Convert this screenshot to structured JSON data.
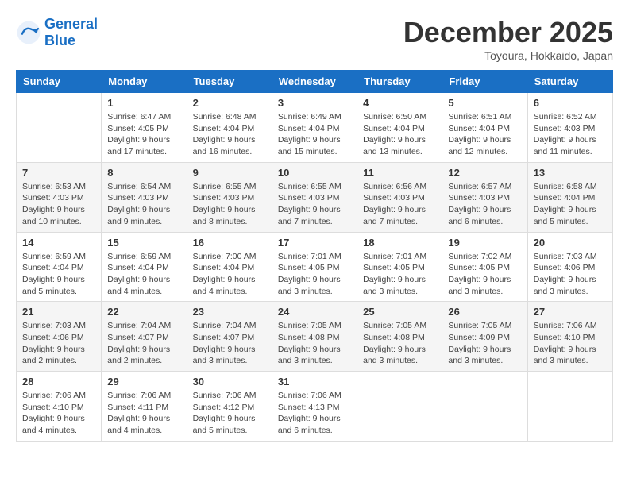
{
  "header": {
    "logo_general": "General",
    "logo_blue": "Blue",
    "month_title": "December 2025",
    "location": "Toyoura, Hokkaido, Japan"
  },
  "weekdays": [
    "Sunday",
    "Monday",
    "Tuesday",
    "Wednesday",
    "Thursday",
    "Friday",
    "Saturday"
  ],
  "weeks": [
    [
      {
        "day": "",
        "sunrise": "",
        "sunset": "",
        "daylight": ""
      },
      {
        "day": "1",
        "sunrise": "Sunrise: 6:47 AM",
        "sunset": "Sunset: 4:05 PM",
        "daylight": "Daylight: 9 hours and 17 minutes."
      },
      {
        "day": "2",
        "sunrise": "Sunrise: 6:48 AM",
        "sunset": "Sunset: 4:04 PM",
        "daylight": "Daylight: 9 hours and 16 minutes."
      },
      {
        "day": "3",
        "sunrise": "Sunrise: 6:49 AM",
        "sunset": "Sunset: 4:04 PM",
        "daylight": "Daylight: 9 hours and 15 minutes."
      },
      {
        "day": "4",
        "sunrise": "Sunrise: 6:50 AM",
        "sunset": "Sunset: 4:04 PM",
        "daylight": "Daylight: 9 hours and 13 minutes."
      },
      {
        "day": "5",
        "sunrise": "Sunrise: 6:51 AM",
        "sunset": "Sunset: 4:04 PM",
        "daylight": "Daylight: 9 hours and 12 minutes."
      },
      {
        "day": "6",
        "sunrise": "Sunrise: 6:52 AM",
        "sunset": "Sunset: 4:03 PM",
        "daylight": "Daylight: 9 hours and 11 minutes."
      }
    ],
    [
      {
        "day": "7",
        "sunrise": "Sunrise: 6:53 AM",
        "sunset": "Sunset: 4:03 PM",
        "daylight": "Daylight: 9 hours and 10 minutes."
      },
      {
        "day": "8",
        "sunrise": "Sunrise: 6:54 AM",
        "sunset": "Sunset: 4:03 PM",
        "daylight": "Daylight: 9 hours and 9 minutes."
      },
      {
        "day": "9",
        "sunrise": "Sunrise: 6:55 AM",
        "sunset": "Sunset: 4:03 PM",
        "daylight": "Daylight: 9 hours and 8 minutes."
      },
      {
        "day": "10",
        "sunrise": "Sunrise: 6:55 AM",
        "sunset": "Sunset: 4:03 PM",
        "daylight": "Daylight: 9 hours and 7 minutes."
      },
      {
        "day": "11",
        "sunrise": "Sunrise: 6:56 AM",
        "sunset": "Sunset: 4:03 PM",
        "daylight": "Daylight: 9 hours and 7 minutes."
      },
      {
        "day": "12",
        "sunrise": "Sunrise: 6:57 AM",
        "sunset": "Sunset: 4:03 PM",
        "daylight": "Daylight: 9 hours and 6 minutes."
      },
      {
        "day": "13",
        "sunrise": "Sunrise: 6:58 AM",
        "sunset": "Sunset: 4:04 PM",
        "daylight": "Daylight: 9 hours and 5 minutes."
      }
    ],
    [
      {
        "day": "14",
        "sunrise": "Sunrise: 6:59 AM",
        "sunset": "Sunset: 4:04 PM",
        "daylight": "Daylight: 9 hours and 5 minutes."
      },
      {
        "day": "15",
        "sunrise": "Sunrise: 6:59 AM",
        "sunset": "Sunset: 4:04 PM",
        "daylight": "Daylight: 9 hours and 4 minutes."
      },
      {
        "day": "16",
        "sunrise": "Sunrise: 7:00 AM",
        "sunset": "Sunset: 4:04 PM",
        "daylight": "Daylight: 9 hours and 4 minutes."
      },
      {
        "day": "17",
        "sunrise": "Sunrise: 7:01 AM",
        "sunset": "Sunset: 4:05 PM",
        "daylight": "Daylight: 9 hours and 3 minutes."
      },
      {
        "day": "18",
        "sunrise": "Sunrise: 7:01 AM",
        "sunset": "Sunset: 4:05 PM",
        "daylight": "Daylight: 9 hours and 3 minutes."
      },
      {
        "day": "19",
        "sunrise": "Sunrise: 7:02 AM",
        "sunset": "Sunset: 4:05 PM",
        "daylight": "Daylight: 9 hours and 3 minutes."
      },
      {
        "day": "20",
        "sunrise": "Sunrise: 7:03 AM",
        "sunset": "Sunset: 4:06 PM",
        "daylight": "Daylight: 9 hours and 3 minutes."
      }
    ],
    [
      {
        "day": "21",
        "sunrise": "Sunrise: 7:03 AM",
        "sunset": "Sunset: 4:06 PM",
        "daylight": "Daylight: 9 hours and 2 minutes."
      },
      {
        "day": "22",
        "sunrise": "Sunrise: 7:04 AM",
        "sunset": "Sunset: 4:07 PM",
        "daylight": "Daylight: 9 hours and 2 minutes."
      },
      {
        "day": "23",
        "sunrise": "Sunrise: 7:04 AM",
        "sunset": "Sunset: 4:07 PM",
        "daylight": "Daylight: 9 hours and 3 minutes."
      },
      {
        "day": "24",
        "sunrise": "Sunrise: 7:05 AM",
        "sunset": "Sunset: 4:08 PM",
        "daylight": "Daylight: 9 hours and 3 minutes."
      },
      {
        "day": "25",
        "sunrise": "Sunrise: 7:05 AM",
        "sunset": "Sunset: 4:08 PM",
        "daylight": "Daylight: 9 hours and 3 minutes."
      },
      {
        "day": "26",
        "sunrise": "Sunrise: 7:05 AM",
        "sunset": "Sunset: 4:09 PM",
        "daylight": "Daylight: 9 hours and 3 minutes."
      },
      {
        "day": "27",
        "sunrise": "Sunrise: 7:06 AM",
        "sunset": "Sunset: 4:10 PM",
        "daylight": "Daylight: 9 hours and 3 minutes."
      }
    ],
    [
      {
        "day": "28",
        "sunrise": "Sunrise: 7:06 AM",
        "sunset": "Sunset: 4:10 PM",
        "daylight": "Daylight: 9 hours and 4 minutes."
      },
      {
        "day": "29",
        "sunrise": "Sunrise: 7:06 AM",
        "sunset": "Sunset: 4:11 PM",
        "daylight": "Daylight: 9 hours and 4 minutes."
      },
      {
        "day": "30",
        "sunrise": "Sunrise: 7:06 AM",
        "sunset": "Sunset: 4:12 PM",
        "daylight": "Daylight: 9 hours and 5 minutes."
      },
      {
        "day": "31",
        "sunrise": "Sunrise: 7:06 AM",
        "sunset": "Sunset: 4:13 PM",
        "daylight": "Daylight: 9 hours and 6 minutes."
      },
      {
        "day": "",
        "sunrise": "",
        "sunset": "",
        "daylight": ""
      },
      {
        "day": "",
        "sunrise": "",
        "sunset": "",
        "daylight": ""
      },
      {
        "day": "",
        "sunrise": "",
        "sunset": "",
        "daylight": ""
      }
    ]
  ]
}
